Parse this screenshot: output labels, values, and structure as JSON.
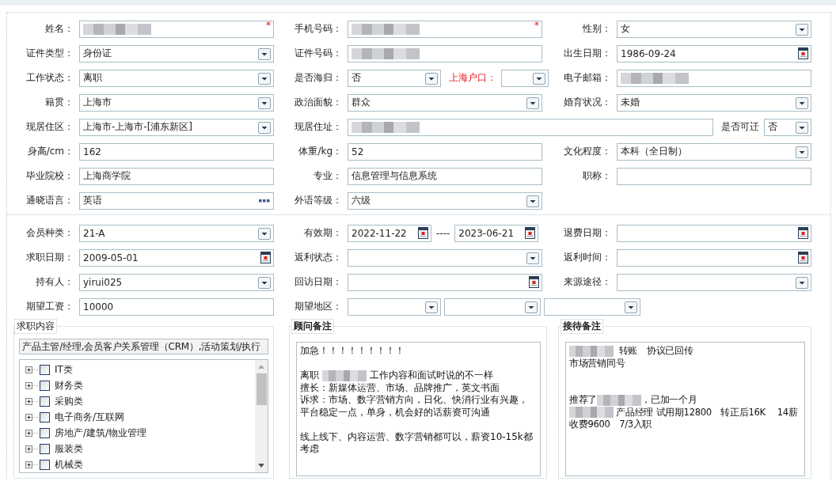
{
  "sections": [
    {
      "rows": [
        {
          "groups": [
            {
              "fields": [
                {
                  "label": "姓名：",
                  "kind": "text",
                  "masked": true,
                  "mark": "*"
                }
              ]
            },
            {
              "fields": [
                {
                  "label": "手机号码：",
                  "kind": "text",
                  "masked": true,
                  "mark": "*"
                }
              ]
            },
            {
              "fields": [
                {
                  "label": "性别：",
                  "kind": "select",
                  "value": "女"
                }
              ]
            }
          ]
        },
        {
          "groups": [
            {
              "fields": [
                {
                  "label": "证件类型：",
                  "kind": "select",
                  "value": "身份证"
                }
              ]
            },
            {
              "fields": [
                {
                  "label": "证件号码：",
                  "kind": "text",
                  "masked": true
                }
              ]
            },
            {
              "fields": [
                {
                  "label": "出生日期：",
                  "kind": "date",
                  "value": "1986-09-24"
                }
              ]
            }
          ]
        },
        {
          "groups": [
            {
              "fields": [
                {
                  "label": "工作状态：",
                  "kind": "select",
                  "value": "离职"
                }
              ]
            },
            {
              "fields": [
                {
                  "label": "是否海归：",
                  "kind": "select",
                  "value": "否"
                },
                {
                  "label": "上海户口：",
                  "kind": "select",
                  "alert": true
                }
              ]
            },
            {
              "fields": [
                {
                  "label": "电子邮箱：",
                  "kind": "text",
                  "masked": true
                }
              ]
            }
          ]
        },
        {
          "groups": [
            {
              "fields": [
                {
                  "label": "籍贯：",
                  "kind": "select",
                  "value": "上海市"
                }
              ]
            },
            {
              "fields": [
                {
                  "label": "政治面貌：",
                  "kind": "select",
                  "value": "群众"
                }
              ]
            },
            {
              "fields": [
                {
                  "label": "婚育状况：",
                  "kind": "select",
                  "value": "未婚"
                }
              ]
            }
          ]
        },
        {
          "groups": [
            {
              "fields": [
                {
                  "label": "现居住区：",
                  "kind": "select",
                  "value": "上海市-上海市-[浦东新区]"
                }
              ]
            },
            {
              "wide": true,
              "fields": [
                {
                  "label": "现居住址：",
                  "kind": "text",
                  "masked": true
                },
                {
                  "label": "是否可迁",
                  "kind": "select",
                  "value": "否"
                }
              ]
            }
          ]
        },
        {
          "groups": [
            {
              "fields": [
                {
                  "label": "身高/cm：",
                  "kind": "text",
                  "value": "162"
                }
              ]
            },
            {
              "fields": [
                {
                  "label": "体重/kg：",
                  "kind": "text",
                  "value": "52"
                }
              ]
            },
            {
              "fields": [
                {
                  "label": "文化程度：",
                  "kind": "select",
                  "value": "本科（全日制）"
                }
              ]
            }
          ]
        },
        {
          "groups": [
            {
              "fields": [
                {
                  "label": "毕业院校：",
                  "kind": "text",
                  "value": "上海商学院"
                }
              ]
            },
            {
              "fields": [
                {
                  "label": "专业：",
                  "kind": "text",
                  "value": "信息管理与信息系统"
                }
              ]
            },
            {
              "fields": [
                {
                  "label": "职称：",
                  "kind": "text"
                }
              ]
            }
          ]
        },
        {
          "groups": [
            {
              "fields": [
                {
                  "label": "通晓语言：",
                  "kind": "lookup",
                  "value": "英语"
                }
              ]
            },
            {
              "fields": [
                {
                  "label": "外语等级：",
                  "kind": "select",
                  "value": "六级"
                }
              ]
            }
          ]
        }
      ]
    },
    {
      "rows": [
        {
          "groups": [
            {
              "fields": [
                {
                  "label": "会员种类：",
                  "kind": "select",
                  "value": "21-A"
                }
              ]
            },
            {
              "fields": [
                {
                  "label": "有效期：",
                  "kind": "daterange",
                  "value": "2022-11-22",
                  "separator": "----",
                  "value_end": "2023-06-21"
                }
              ]
            },
            {
              "fields": [
                {
                  "label": "退费日期：",
                  "kind": "date"
                }
              ]
            }
          ]
        },
        {
          "groups": [
            {
              "fields": [
                {
                  "label": "求职日期：",
                  "kind": "date",
                  "value": "2009-05-01"
                }
              ]
            },
            {
              "fields": [
                {
                  "label": "返利状态：",
                  "kind": "select"
                }
              ]
            },
            {
              "fields": [
                {
                  "label": "返利时间：",
                  "kind": "date"
                }
              ]
            }
          ]
        },
        {
          "groups": [
            {
              "fields": [
                {
                  "label": "持有人：",
                  "kind": "select",
                  "value": "yirui025"
                }
              ]
            },
            {
              "fields": [
                {
                  "label": "回访日期：",
                  "kind": "date"
                }
              ]
            },
            {
              "fields": [
                {
                  "label": "来源途径：",
                  "kind": "select"
                }
              ]
            }
          ]
        },
        {
          "groups": [
            {
              "fields": [
                {
                  "label": "期望工资：",
                  "kind": "text",
                  "value": "10000"
                }
              ]
            },
            {
              "fields": [
                {
                  "label": "期望地区：",
                  "kind": "select"
                },
                {
                  "kind": "select"
                },
                {
                  "kind": "select"
                }
              ]
            }
          ]
        }
      ]
    }
  ],
  "job_panel": {
    "title": "求职内容",
    "summary": "产品主管/经理,会员客户关系管理（CRM）,活动策划/执行",
    "items": [
      {
        "label": "IT类",
        "expanded": false,
        "checked": false
      },
      {
        "label": "财务类",
        "expanded": false,
        "checked": false
      },
      {
        "label": "采购类",
        "expanded": false,
        "checked": false
      },
      {
        "label": "电子商务/互联网",
        "expanded": false,
        "checked": false
      },
      {
        "label": "房地产/建筑/物业管理",
        "expanded": false,
        "checked": false
      },
      {
        "label": "服装类",
        "expanded": false,
        "checked": false
      },
      {
        "label": "机械类",
        "expanded": false,
        "checked": false
      }
    ]
  },
  "notes": [
    {
      "title": "顾问备注",
      "lines": [
        {
          "kind": "text",
          "parts": [
            {
              "text": "加急！！！！！！！！！"
            }
          ]
        },
        {
          "kind": "blank"
        },
        {
          "kind": "text",
          "parts": [
            {
              "text": "离职 "
            },
            {
              "kind": "masked"
            },
            {
              "text": " 工作内容和面试时说的不一样"
            }
          ]
        },
        {
          "kind": "text",
          "parts": [
            {
              "text": "擅长：新媒体运营、市场、品牌推广，英文书面"
            }
          ]
        },
        {
          "kind": "text",
          "parts": [
            {
              "text": "诉求：市场、数字营销方向，日化、快消行业有兴趣，"
            }
          ]
        },
        {
          "kind": "text",
          "parts": [
            {
              "text": "平台稳定一点，单身，机会好的话薪资可沟通"
            }
          ]
        },
        {
          "kind": "blank"
        },
        {
          "kind": "text",
          "parts": [
            {
              "text": "线上线下、内容运营、数字营销都可以，薪资10-15k都"
            }
          ]
        },
        {
          "kind": "text",
          "parts": [
            {
              "text": "考虑"
            }
          ]
        }
      ]
    },
    {
      "title": "接待备注",
      "lines": [
        {
          "kind": "text",
          "parts": [
            {
              "kind": "masked"
            },
            {
              "text": "  转账　协议已回传"
            }
          ]
        },
        {
          "kind": "text",
          "parts": [
            {
              "text": "市场营销同号"
            }
          ]
        },
        {
          "kind": "blank"
        },
        {
          "kind": "blank"
        },
        {
          "kind": "text",
          "parts": [
            {
              "text": "推荐了"
            },
            {
              "kind": "masked"
            },
            {
              "text": "，已加一个月"
            }
          ]
        },
        {
          "kind": "text",
          "parts": [
            {
              "kind": "masked"
            },
            {
              "text": " 产品经理 试用期12800　转正后16K　 14薪"
            }
          ]
        },
        {
          "kind": "text",
          "parts": [
            {
              "text": "收费9600　7/3入职"
            }
          ]
        }
      ]
    }
  ]
}
